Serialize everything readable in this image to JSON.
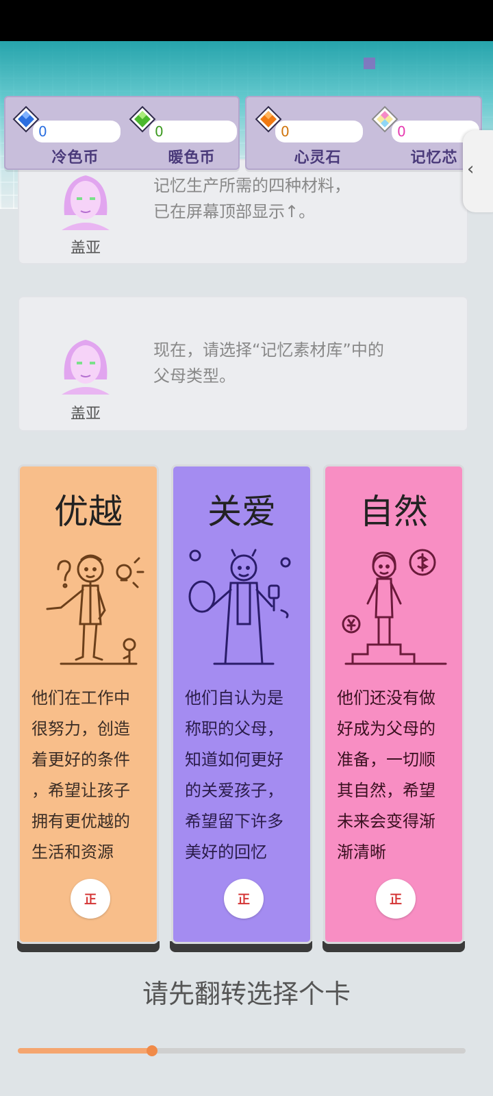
{
  "resources": {
    "left": [
      {
        "label": "冷色币",
        "value": "0",
        "color": "#2b6fe0"
      },
      {
        "label": "暖色币",
        "value": "0",
        "color": "#4bb82d"
      }
    ],
    "right": [
      {
        "label": "心灵石",
        "value": "0",
        "color": "#f07a12"
      },
      {
        "label": "记忆芯",
        "value": "0",
        "color": "#e63bb0"
      }
    ]
  },
  "dialogs": [
    {
      "speaker": "盖亚",
      "line1": "记忆生产所需的四种材料，",
      "line2": "已在屏幕顶部显示↑。"
    },
    {
      "speaker": "盖亚",
      "line1": "现在，请选择“记忆素材库”中的",
      "line2": "父母类型。"
    }
  ],
  "cards": [
    {
      "title": "优越",
      "bg": "#f8be8a",
      "illus": "thinking-man-illustration",
      "lines": [
        "他们在工作中",
        "很努力，创造",
        "着更好的条件",
        "，希望让孩子",
        "拥有更优越的",
        "生活和资源"
      ],
      "badge": "正"
    },
    {
      "title": "关爱",
      "bg": "#a48cf1",
      "illus": "cooking-parent-illustration",
      "lines": [
        "他们自认为是",
        "称职的父母，",
        "知道如何更好",
        "的关爱孩子，",
        "希望留下许多",
        "美好的回忆"
      ],
      "badge": "正"
    },
    {
      "title": "自然",
      "bg": "#f88ec3",
      "illus": "woman-on-steps-illustration",
      "lines": [
        "他们还没有做",
        "好成为父母的",
        "准备，一切顺",
        "其自然，希望",
        "未来会变得渐",
        "渐清晰"
      ],
      "badge": "正"
    }
  ],
  "hint": "请先翻转选择个卡",
  "progress": 0.3,
  "colors": {
    "accent": "#f08a48",
    "panel": "#c8bedb"
  }
}
